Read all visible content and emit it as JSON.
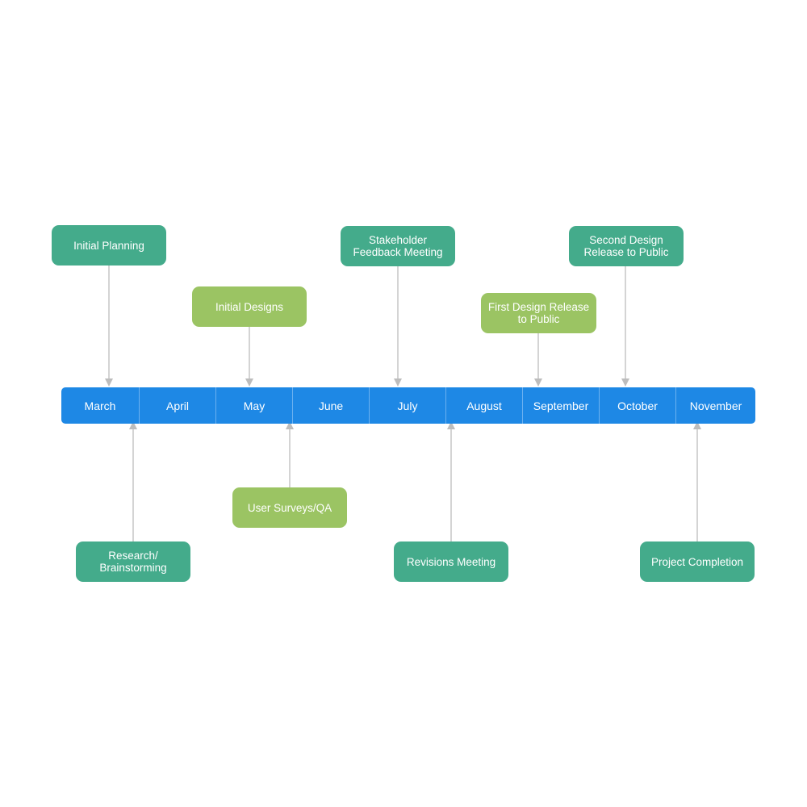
{
  "diagram": {
    "type": "timeline",
    "colors": {
      "bar": "#1e88e5",
      "bar_divider": "#6cb1f0",
      "teal_event": "#44ab8b",
      "green_event": "#9bc463",
      "connector": "#bdbdbd",
      "text": "#ffffff"
    },
    "months": [
      "March",
      "April",
      "May",
      "June",
      "July",
      "August",
      "September",
      "October",
      "November"
    ],
    "events_above": [
      {
        "label": "Initial Planning",
        "color": "teal",
        "month": "March"
      },
      {
        "label": "Initial Designs",
        "color": "green",
        "month": "May"
      },
      {
        "label": "Stakeholder\nFeedback Meeting",
        "color": "teal",
        "month": "July"
      },
      {
        "label": "First Design Release\nto Public",
        "color": "green",
        "month": "September"
      },
      {
        "label": "Second Design\nRelease to Public",
        "color": "teal",
        "month": "October"
      }
    ],
    "events_below": [
      {
        "label": "Research/\nBrainstorming",
        "color": "teal",
        "month": "March-April boundary"
      },
      {
        "label": "User Surveys/QA",
        "color": "green",
        "month": "May-June boundary"
      },
      {
        "label": "Revisions Meeting",
        "color": "teal",
        "month": "July-August boundary"
      },
      {
        "label": "Project Completion",
        "color": "teal",
        "month": "November"
      }
    ]
  }
}
